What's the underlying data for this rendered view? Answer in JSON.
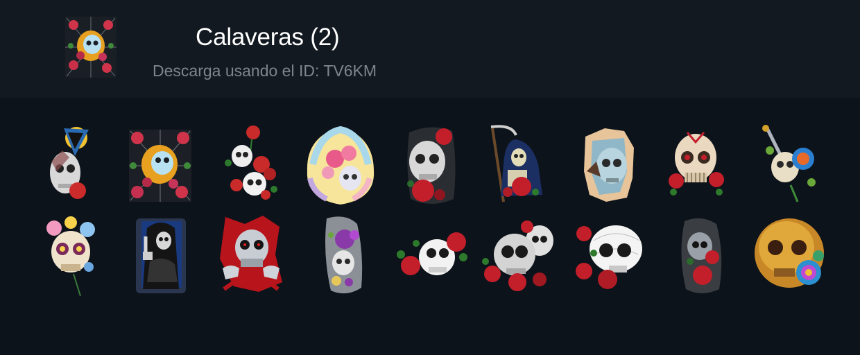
{
  "pack": {
    "title": "Calaveras (2)",
    "subtitle": "Descarga usando el ID: TV6KM",
    "thumbnail_icon": "skull-rose-web-icon"
  },
  "stickers": [
    {
      "name": "skull-triangle-sunflower-sticker",
      "style": "triangle"
    },
    {
      "name": "skull-roses-spiderweb-sticker",
      "style": "web"
    },
    {
      "name": "two-skulls-roses-sticker",
      "style": "two"
    },
    {
      "name": "skull-feathers-flowers-sticker",
      "style": "feathers"
    },
    {
      "name": "skull-red-roses-sticker",
      "style": "roses"
    },
    {
      "name": "grim-reaper-scythe-sticker",
      "style": "reaper"
    },
    {
      "name": "skull-torn-paper-sticker",
      "style": "torn"
    },
    {
      "name": "sugar-skull-roses-sticker",
      "style": "sugar"
    },
    {
      "name": "skull-dagger-rose-sticker",
      "style": "dagger"
    },
    {
      "name": "skull-flower-crown-sticker",
      "style": "crown"
    },
    {
      "name": "grim-reaper-middle-finger-sticker",
      "style": "reaper2"
    },
    {
      "name": "skull-ripping-through-sticker",
      "style": "rip"
    },
    {
      "name": "skull-purple-rose-sticker",
      "style": "purple"
    },
    {
      "name": "skull-roses-sideways-sticker",
      "style": "side"
    },
    {
      "name": "two-skulls-roses-pile-sticker",
      "style": "pile"
    },
    {
      "name": "skull-sketch-roses-sticker",
      "style": "sketch"
    },
    {
      "name": "skull-smoke-roses-sticker",
      "style": "smoke"
    },
    {
      "name": "golden-skull-rainbow-rose-sticker",
      "style": "golden"
    }
  ],
  "colors": {
    "background": "#0d131a",
    "header": "#131920",
    "title": "#ffffff",
    "subtitle": "#7d858d"
  }
}
